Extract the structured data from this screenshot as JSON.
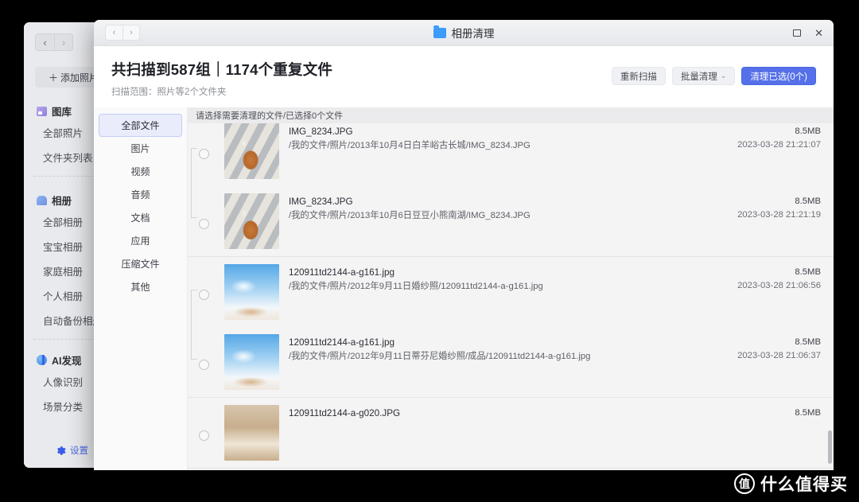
{
  "app": {
    "nav": {
      "back": "‹",
      "forward": "›"
    },
    "add_photo_label": "添加照片",
    "add_photo_plus": "＋",
    "sections": [
      {
        "title": "图库",
        "icon": "gallery-icon",
        "items": [
          "全部照片",
          "文件夹列表"
        ]
      },
      {
        "title": "相册",
        "icon": "album-icon",
        "items": [
          "全部相册",
          "宝宝相册",
          "家庭相册",
          "个人相册",
          "自动备份相册"
        ]
      },
      {
        "title": "AI发现",
        "icon": "ai-icon",
        "active": true,
        "items": [
          "人像识别",
          "场景分类"
        ]
      }
    ],
    "settings_label": "设置",
    "settings_icon": "gear-icon"
  },
  "dialog": {
    "nav": {
      "back": "‹",
      "forward": "›"
    },
    "title": "相册清理",
    "title_icon": "folder-icon",
    "window_controls": {
      "maximize": "maximize-icon",
      "close": "✕"
    },
    "scan_title": "共扫描到587组｜1174个重复文件",
    "scan_subtitle": "扫描范围：照片等2个文件夹",
    "actions": {
      "rescan": "重新扫描",
      "batch_clean": "批量清理",
      "batch_caret": "⌄",
      "clean_selected": "清理已选(0个)",
      "primary_color": "#5570e8"
    },
    "list_header": "请选择需要清理的文件/已选择0个文件",
    "categories": [
      {
        "label": "全部文件",
        "active": true
      },
      {
        "label": "图片",
        "active": false
      },
      {
        "label": "视频",
        "active": false
      },
      {
        "label": "音频",
        "active": false
      },
      {
        "label": "文档",
        "active": false
      },
      {
        "label": "应用",
        "active": false
      },
      {
        "label": "压缩文件",
        "active": false
      },
      {
        "label": "其他",
        "active": false
      }
    ],
    "groups": [
      {
        "rows": [
          {
            "name": "",
            "path": "",
            "size": "",
            "time": "",
            "thumb": "road",
            "partial": true
          },
          {
            "name": "IMG_8234.JPG",
            "path": "/我的文件/照片/2013年10月4日白羊峪古长城/IMG_8234.JPG",
            "size": "8.5MB",
            "time": "2023-03-28 21:21:07",
            "thumb": "dog"
          },
          {
            "name": "IMG_8234.JPG",
            "path": "/我的文件/照片/2013年10月6日豆豆小熊南湖/IMG_8234.JPG",
            "size": "8.5MB",
            "time": "2023-03-28 21:21:19",
            "thumb": "dog"
          }
        ]
      },
      {
        "rows": [
          {
            "name": "120911td2144-a-g161.jpg",
            "path": "/我的文件/照片/2012年9月11日婚纱照/120911td2144-a-g161.jpg",
            "size": "8.5MB",
            "time": "2023-03-28 21:06:56",
            "thumb": "sky"
          },
          {
            "name": "120911td2144-a-g161.jpg",
            "path": "/我的文件/照片/2012年9月11日蒂芬尼婚纱照/成品/120911td2144-a-g161.jpg",
            "size": "8.5MB",
            "time": "2023-03-28 21:06:37",
            "thumb": "sky"
          }
        ]
      },
      {
        "rows": [
          {
            "name": "120911td2144-a-g020.JPG",
            "path": "",
            "size": "8.5MB",
            "time": "",
            "thumb": "beach"
          }
        ]
      }
    ]
  },
  "watermark": {
    "badge": "值",
    "text": "什么值得买"
  }
}
